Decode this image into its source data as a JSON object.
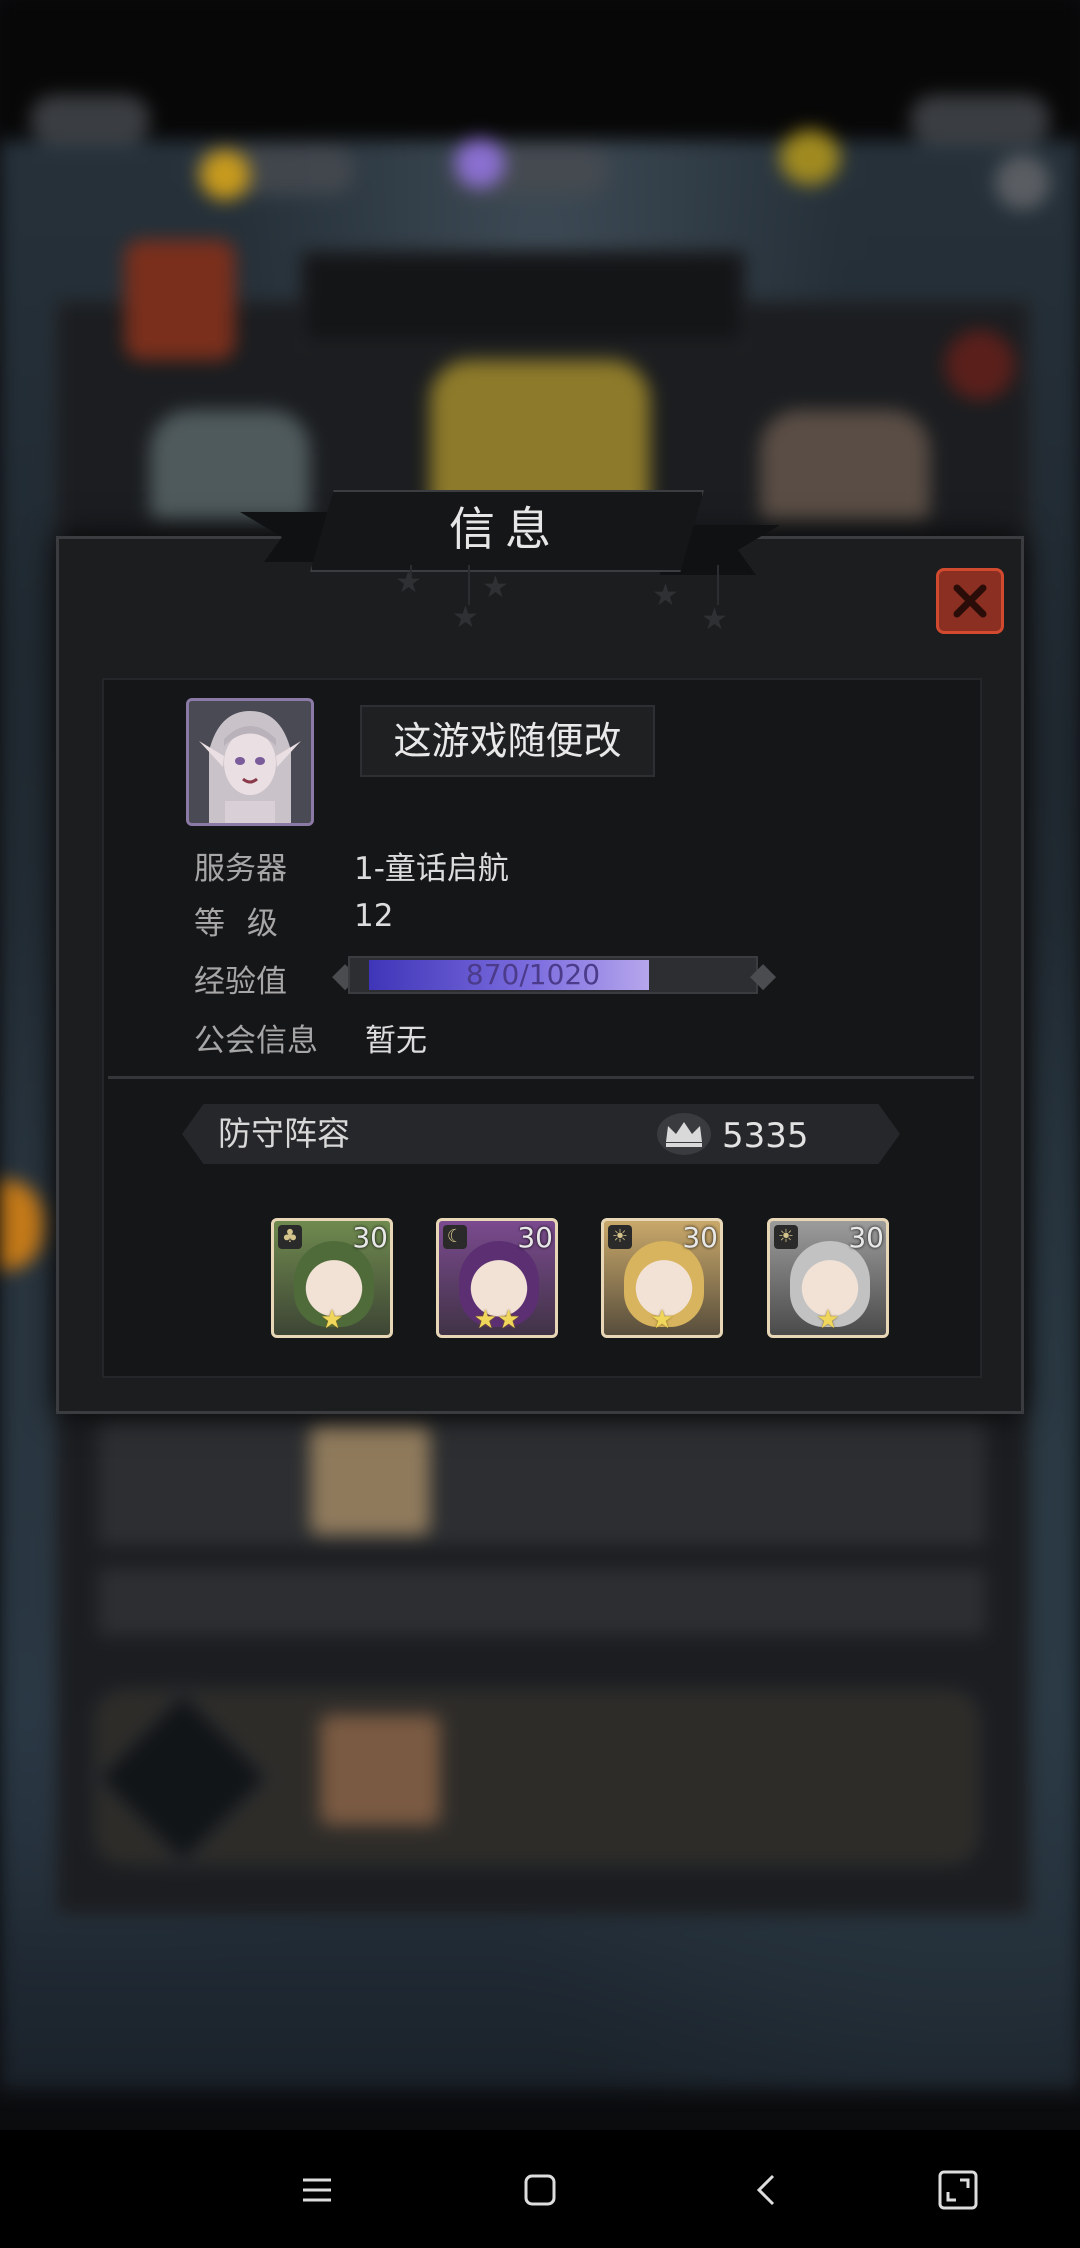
{
  "dialog": {
    "title": "信息",
    "player": {
      "name": "这游戏随便改",
      "server_label": "服务器",
      "server_value": "1-童话启航",
      "level_label": "等 级",
      "level_value": "12",
      "exp_label": "经验值",
      "exp_text": "870/1020",
      "exp_current": 870,
      "exp_max": 1020,
      "guild_label": "公会信息",
      "guild_value": "暂无"
    },
    "defense": {
      "title": "防守阵容",
      "power": "5335",
      "heroes": [
        {
          "level": "30",
          "stars": 1,
          "class_icon": "club-icon",
          "color": "#6f8a4f",
          "hair": "#4f6b3a"
        },
        {
          "level": "30",
          "stars": 2,
          "class_icon": "moon-icon",
          "color": "#7a4a8e",
          "hair": "#5b2f72"
        },
        {
          "level": "30",
          "stars": 1,
          "class_icon": "sun-icon",
          "color": "#c9a86a",
          "hair": "#d8b45e"
        },
        {
          "level": "30",
          "stars": 1,
          "class_icon": "sun-icon",
          "color": "#9c9c9c",
          "hair": "#c2c2c2"
        }
      ]
    }
  },
  "colors": {
    "close_button": "#8a2f22",
    "exp_fill_start": "#3f35b8",
    "exp_fill_end": "#b6a6ec",
    "star": "#f0d65a"
  },
  "navbar": {
    "icons": [
      "menu-icon",
      "home-icon",
      "back-icon",
      "screenshot-icon"
    ]
  }
}
